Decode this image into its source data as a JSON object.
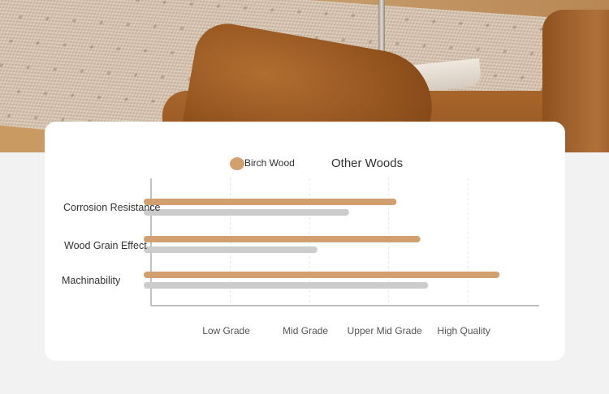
{
  "chart_data": {
    "type": "bar",
    "orientation": "horizontal",
    "categories": [
      "Corrosion Resistance",
      "Wood Grain Effect",
      "Machinability"
    ],
    "series": [
      {
        "name": "Birch Wood",
        "color": "#d2a06e",
        "values": [
          3.1,
          3.4,
          4.4
        ]
      },
      {
        "name": "Other Woods",
        "color": "#cccccc",
        "values": [
          2.5,
          2.1,
          3.5
        ]
      }
    ],
    "x_tick_labels": [
      "Low Grade",
      "Mid Grade",
      "Upper Mid Grade",
      "High Quality"
    ],
    "x_tick_values": [
      1,
      2,
      3,
      4
    ],
    "xlim": [
      0,
      4.9
    ],
    "grid": true,
    "legend_position": "top-center"
  },
  "photo": {
    "subject": "sofa-and-rug-photo"
  }
}
